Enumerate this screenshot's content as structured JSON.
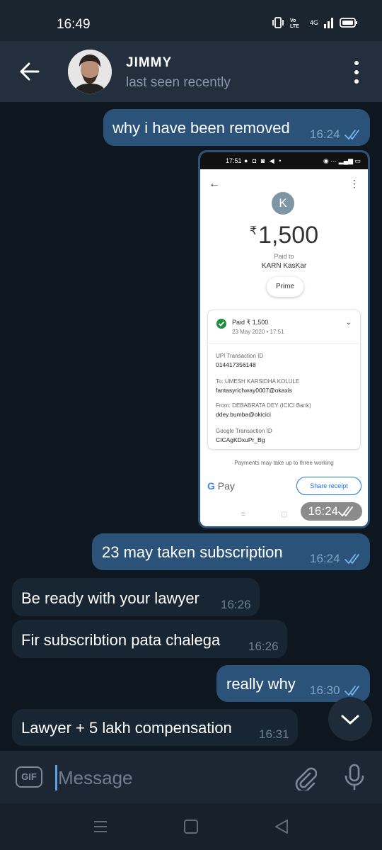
{
  "status_bar": {
    "time": "16:49",
    "network": "4G"
  },
  "header": {
    "name": "JIMMY",
    "status": "last seen recently"
  },
  "messages": [
    {
      "direction": "out",
      "text": "why i have been removed",
      "time": "16:24",
      "read": true
    },
    {
      "direction": "out",
      "type": "photo",
      "time": "16:24",
      "read": true
    },
    {
      "direction": "out",
      "text": "23 may taken subscription",
      "time": "16:24",
      "read": true
    },
    {
      "direction": "in",
      "text": "Be ready with your lawyer",
      "time": "16:26"
    },
    {
      "direction": "in",
      "text": "Fir subscribtion pata chalega",
      "time": "16:26"
    },
    {
      "direction": "out",
      "text": "really why",
      "time": "16:30",
      "read": true
    },
    {
      "direction": "in",
      "text": "Lawyer + 5 lakh compensation",
      "time": "16:31"
    }
  ],
  "screenshot": {
    "status_time": "17:51",
    "avatar_letter": "K",
    "currency": "₹",
    "amount": "1,500",
    "paid_to_label": "Paid to",
    "payee": "KARN KasKar",
    "chip": "Prime",
    "paid_line": "Paid ₹ 1,500",
    "date": "23 May 2020 • 17:51",
    "details": [
      {
        "key": "UPI Transaction ID",
        "value": "014417356148"
      },
      {
        "key": "To: UMESH KARSIDHA KOLULE",
        "value": "fantasyrichway0007@okaxis"
      },
      {
        "key": "From: DEBABRATA DEY (ICICI Bank)",
        "value": "ddey.bumba@okicici"
      },
      {
        "key": "Google Transaction ID",
        "value": "CICAgKDxuPr_Bg"
      }
    ],
    "note": "Payments may take up to three working",
    "gpay_g": "G",
    "gpay_pay": "Pay",
    "share": "Share receipt"
  },
  "input": {
    "placeholder": "Message",
    "gif_label": "GIF"
  },
  "colors": {
    "outgoing": "#2b5278",
    "incoming": "#182533",
    "background": "#0e1720",
    "header": "#232f3d",
    "accent": "#5ea2e5"
  }
}
